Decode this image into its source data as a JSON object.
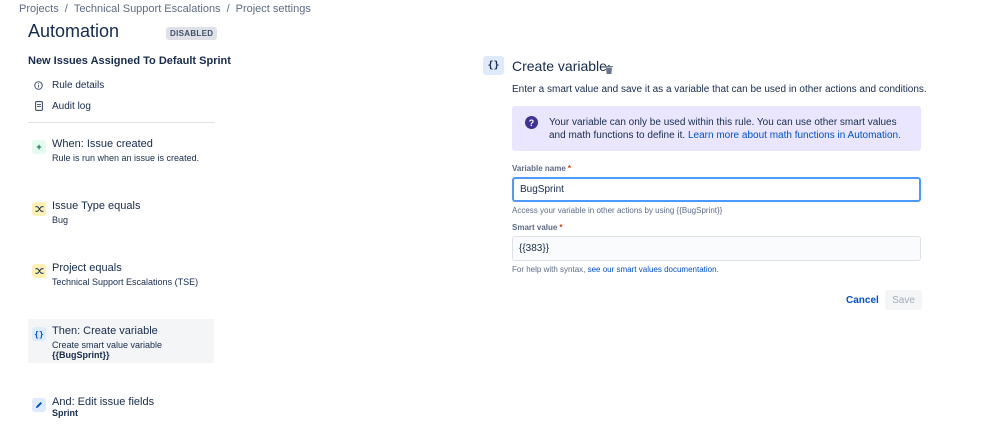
{
  "breadcrumb": {
    "items": [
      "Projects",
      "Technical Support Escalations",
      "Project settings"
    ],
    "separator": "/"
  },
  "header": {
    "title": "Automation",
    "status_badge": "DISABLED"
  },
  "rule": {
    "name": "New Issues Assigned To Default Sprint"
  },
  "nav": {
    "rule_details": "Rule details",
    "audit_log": "Audit log"
  },
  "components": [
    {
      "title": "When: Issue created",
      "desc": "Rule is run when an issue is created.",
      "icon": "plus-icon"
    },
    {
      "title": "Issue Type equals",
      "desc": "Bug",
      "icon": "shuffle-icon"
    },
    {
      "title": "Project equals",
      "desc": "Technical Support Escalations (TSE)",
      "icon": "shuffle-icon"
    },
    {
      "title": "Then: Create variable",
      "desc": "Create smart value variable",
      "desc2": "{{BugSprint}}",
      "icon": "braces-icon"
    },
    {
      "title": "And: Edit issue fields",
      "desc2": "Sprint",
      "icon": "pencil-icon"
    }
  ],
  "panel": {
    "icon_text": "{}",
    "title": "Create variable",
    "description": "Enter a smart value and save it as a variable that can be used in other actions and conditions.",
    "info": {
      "text": "Your variable can only be used within this rule. You can use other smart values and math functions to define it.",
      "link": "Learn more about math functions in Automation."
    },
    "variable_name": {
      "label": "Variable name",
      "required_mark": "*",
      "value": "BugSprint",
      "hint": "Access your variable in other actions by using {{BugSprint}}"
    },
    "smart_value": {
      "label": "Smart value",
      "required_mark": "*",
      "value": "{{383}}",
      "hint_prefix": "For help with syntax,",
      "hint_link": "see our smart values documentation."
    },
    "cancel_label": "Cancel",
    "save_label": "Save"
  },
  "colors": {
    "accent": "#0052cc",
    "info_bg": "#eae6ff",
    "focus_border": "#4c9aff",
    "trigger_icon_bg": "#e3fcef",
    "condition_icon_bg": "#fff0b3",
    "action_icon_bg": "#deebff"
  }
}
